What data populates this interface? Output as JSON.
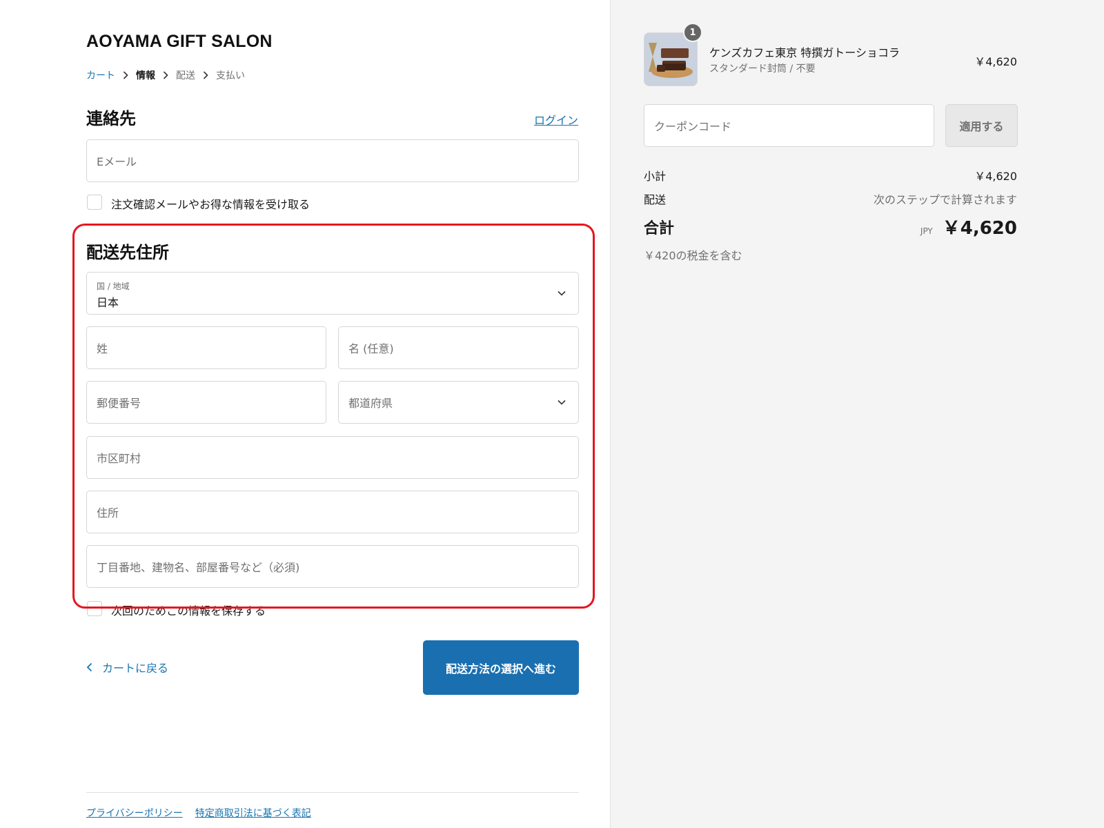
{
  "store": {
    "title": "AOYAMA GIFT SALON"
  },
  "breadcrumb": {
    "items": [
      "カート",
      "情報",
      "配送",
      "支払い"
    ]
  },
  "contact": {
    "heading": "連絡先",
    "login_link": "ログイン",
    "email_placeholder": "Eメール",
    "newsletter_label": "注文確認メールやお得な情報を受け取る"
  },
  "shipping": {
    "heading": "配送先住所",
    "country_label": "国 / 地域",
    "country_value": "日本",
    "last_name_placeholder": "姓",
    "first_name_placeholder": "名 (任意)",
    "postal_placeholder": "郵便番号",
    "prefecture_placeholder": "都道府県",
    "city_placeholder": "市区町村",
    "address_placeholder": "住所",
    "address2_placeholder": "丁目番地、建物名、部屋番号など（必須)",
    "save_info_label": "次回のためこの情報を保存する"
  },
  "actions": {
    "back_label": "カートに戻る",
    "continue_label": "配送方法の選択へ進む"
  },
  "footer": {
    "links": [
      "プライバシーポリシー",
      "特定商取引法に基づく表記"
    ]
  },
  "summary": {
    "item": {
      "quantity": "1",
      "name": "ケンズカフェ東京 特撰ガトーショコラ",
      "variant": "スタンダード封筒 / 不要",
      "price": "￥4,620"
    },
    "coupon_placeholder": "クーポンコード",
    "apply_label": "適用する",
    "subtotal_label": "小計",
    "subtotal_value": "￥4,620",
    "shipping_label": "配送",
    "shipping_value": "次のステップで計算されます",
    "total_label": "合計",
    "currency": "JPY",
    "total_value": "￥4,620",
    "tax_note": "￥420の税金を含む"
  },
  "colors": {
    "link": "#1773b0",
    "primary_button": "#1a6fb0",
    "highlight": "#e5161e",
    "sidebar_bg": "#f4f4f4"
  }
}
